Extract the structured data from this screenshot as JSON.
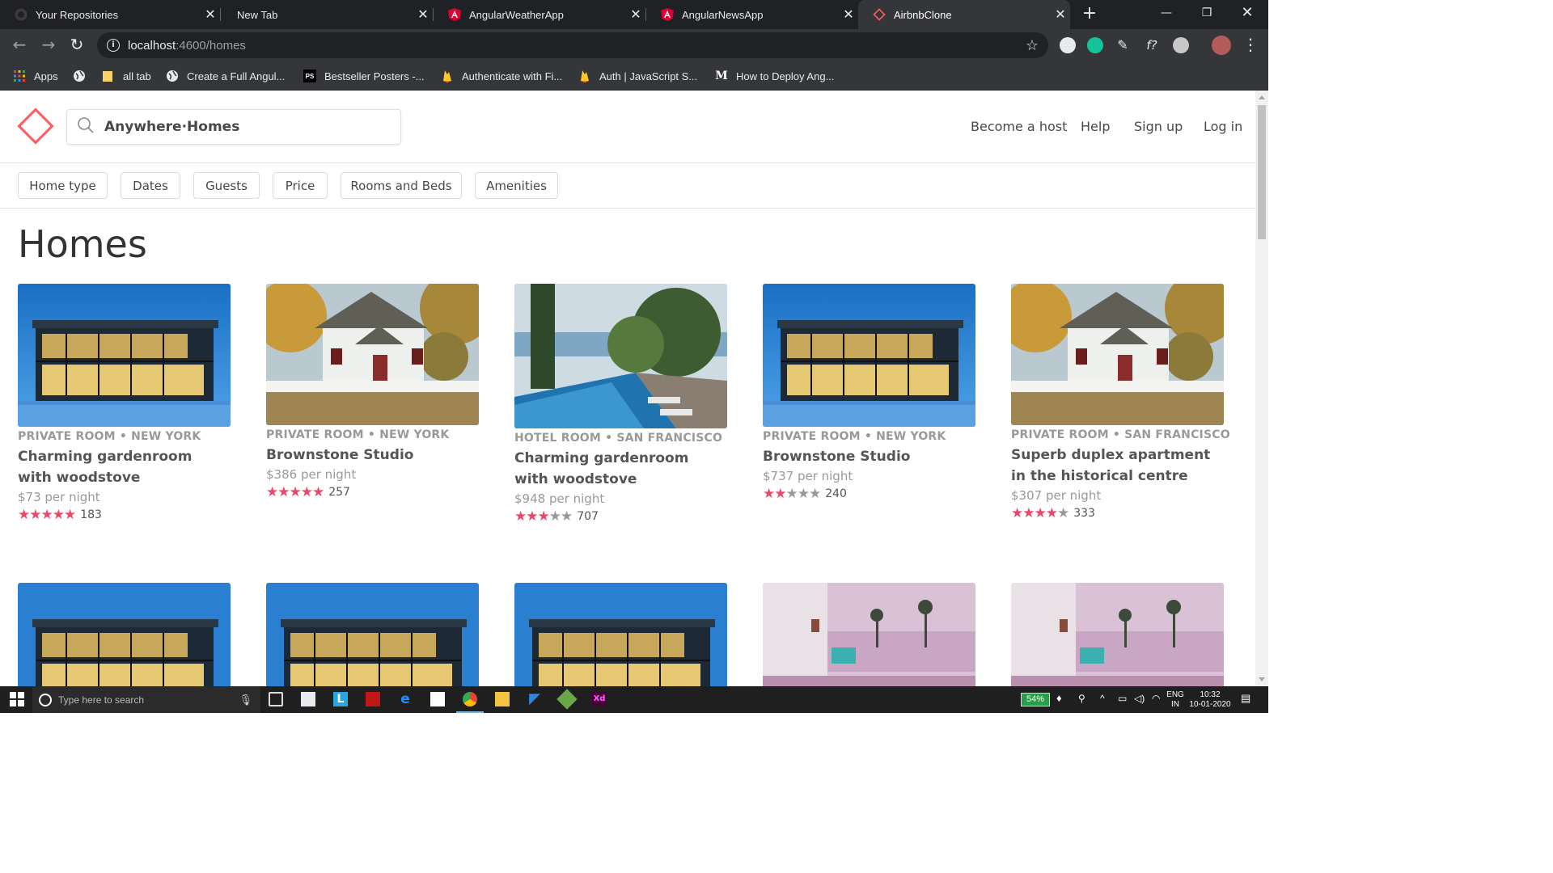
{
  "browser": {
    "tabs": [
      {
        "label": "Your Repositories",
        "icon": "github-icon",
        "active": false
      },
      {
        "label": "New Tab",
        "icon": "",
        "active": false
      },
      {
        "label": "AngularWeatherApp",
        "icon": "angular-icon",
        "active": false
      },
      {
        "label": "AngularNewsApp",
        "icon": "angular-icon",
        "active": false
      },
      {
        "label": "AirbnbClone",
        "icon": "airbnb-diamond-icon",
        "active": true
      }
    ],
    "url_host": "localhost",
    "url_rest": ":4600/homes",
    "bookmarks": [
      {
        "label": "Apps",
        "icon": "apps-grid-icon"
      },
      {
        "label": "",
        "icon": "globe-icon"
      },
      {
        "label": "all tab",
        "icon": "folder-icon"
      },
      {
        "label": "Create a Full Angul...",
        "icon": "globe-icon"
      },
      {
        "label": "Bestseller Posters -...",
        "icon": "ps-icon"
      },
      {
        "label": "Authenticate with Fi...",
        "icon": "firebase-icon"
      },
      {
        "label": "Auth | JavaScript S...",
        "icon": "firebase-icon"
      },
      {
        "label": "How to Deploy Ang...",
        "icon": "medium-icon"
      }
    ]
  },
  "site": {
    "search_text": "Anywhere·Homes",
    "nav": [
      "Become a host",
      "Help",
      "Sign up",
      "Log in"
    ],
    "filters": [
      "Home type",
      "Dates",
      "Guests",
      "Price",
      "Rooms and Beds",
      "Amenities"
    ],
    "heading": "Homes",
    "accent": "#ff5a5f",
    "star_color": "#e8486b"
  },
  "listings": [
    {
      "meta": "PRIVATE ROOM • NEW YORK",
      "name": "Charming gardenroom with woodstove",
      "price": "$73 per night",
      "stars": 5,
      "reviews": "183",
      "image": "modern-house-night"
    },
    {
      "meta": "PRIVATE ROOM • NEW YORK",
      "name": "Brownstone Studio",
      "price": "$386 per night",
      "stars": 5,
      "reviews": "257",
      "image": "white-cottage-autumn"
    },
    {
      "meta": "HOTEL ROOM • SAN FRANCISCO",
      "name": "Charming gardenroom with woodstove",
      "price": "$948 per night",
      "stars": 3,
      "reviews": "707",
      "image": "pool-ocean-view"
    },
    {
      "meta": "PRIVATE ROOM • NEW YORK",
      "name": "Brownstone Studio",
      "price": "$737 per night",
      "stars": 2,
      "reviews": "240",
      "image": "modern-house-night"
    },
    {
      "meta": "PRIVATE ROOM • SAN FRANCISCO",
      "name": "Superb duplex apartment in the historical centre",
      "price": "$307 per night",
      "stars": 4,
      "reviews": "333",
      "image": "white-cottage-autumn"
    }
  ],
  "listings_row2": [
    {
      "image": "modern-house-night"
    },
    {
      "image": "modern-house-night"
    },
    {
      "image": "modern-house-night"
    },
    {
      "image": "pink-terrace-palms"
    },
    {
      "image": "pink-terrace-palms"
    }
  ],
  "taskbar": {
    "search_placeholder": "Type here to search",
    "battery": "54%",
    "lang_top": "ENG",
    "lang_bottom": "IN",
    "time": "10:32",
    "date": "10-01-2020"
  }
}
